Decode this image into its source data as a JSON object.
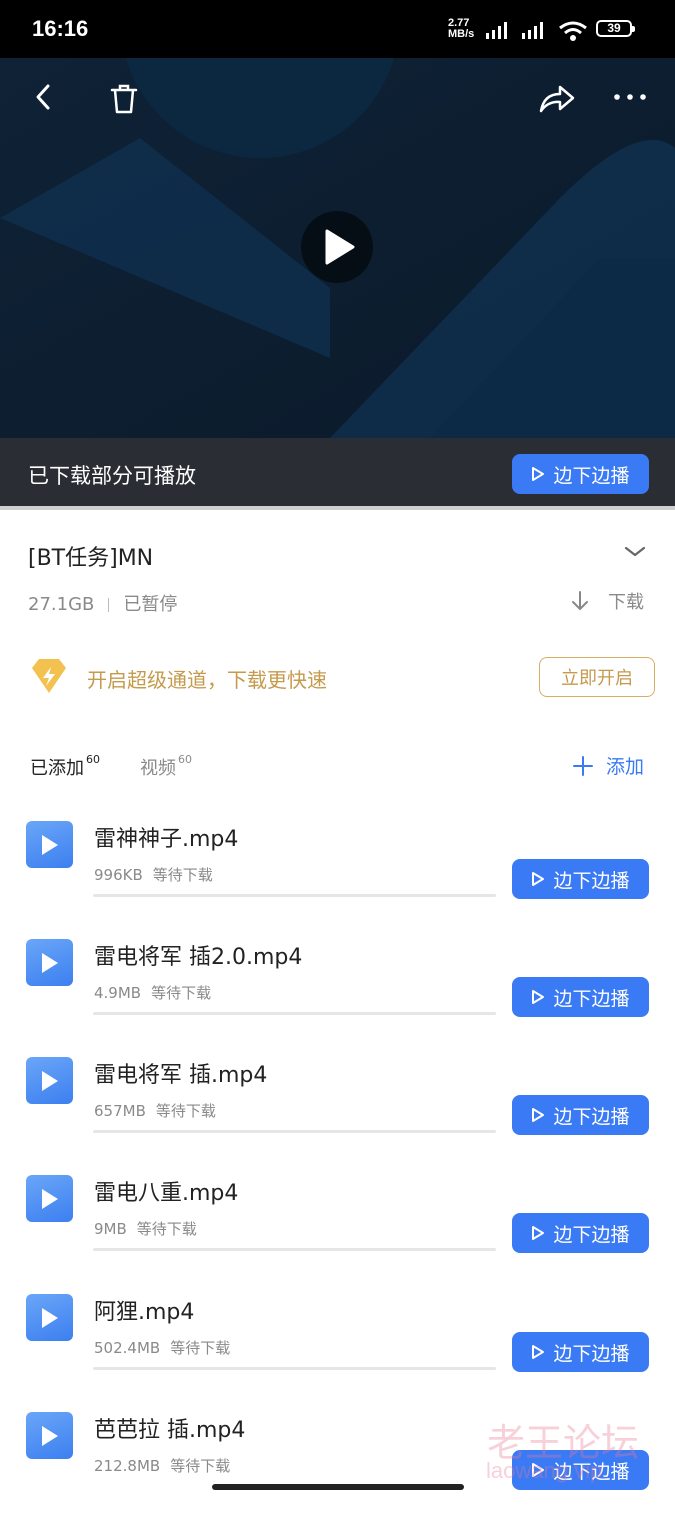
{
  "status_bar": {
    "time": "16:16",
    "speed_value": "2.77",
    "speed_unit": "MB/s",
    "battery": "39"
  },
  "video": {
    "play_icon": "play-icon",
    "downloaded_text": "已下载部分可播放",
    "play_while_download_label": "边下边播"
  },
  "task": {
    "title": "[BT任务]MN",
    "size": "27.1GB",
    "status": "已暂停",
    "download_label": "下载"
  },
  "promo": {
    "text": "开启超级通道，下载更快速",
    "button_label": "立即开启",
    "accent_color": "#c59a4d"
  },
  "tabs": {
    "added_label": "已添加",
    "added_count": "60",
    "video_label": "视频",
    "video_count": "60",
    "add_label": "添加"
  },
  "files": [
    {
      "name": "雷神神子.mp4",
      "size": "996KB",
      "status": "等待下载",
      "button": "边下边播"
    },
    {
      "name": "雷电将军 插2.0.mp4",
      "size": "4.9MB",
      "status": "等待下载",
      "button": "边下边播"
    },
    {
      "name": "雷电将军 插.mp4",
      "size": "657MB",
      "status": "等待下载",
      "button": "边下边播"
    },
    {
      "name": "雷电八重.mp4",
      "size": "9MB",
      "status": "等待下载",
      "button": "边下边播"
    },
    {
      "name": "阿狸.mp4",
      "size": "502.4MB",
      "status": "等待下载",
      "button": "边下边播"
    },
    {
      "name": "芭芭拉 插.mp4",
      "size": "212.8MB",
      "status": "等待下载",
      "button": "边下边播"
    }
  ],
  "watermark": {
    "title": "老王论坛",
    "url": "laowang.vip"
  },
  "colors": {
    "accent_blue": "#3b7af5",
    "promo_gold": "#c59a4d"
  }
}
